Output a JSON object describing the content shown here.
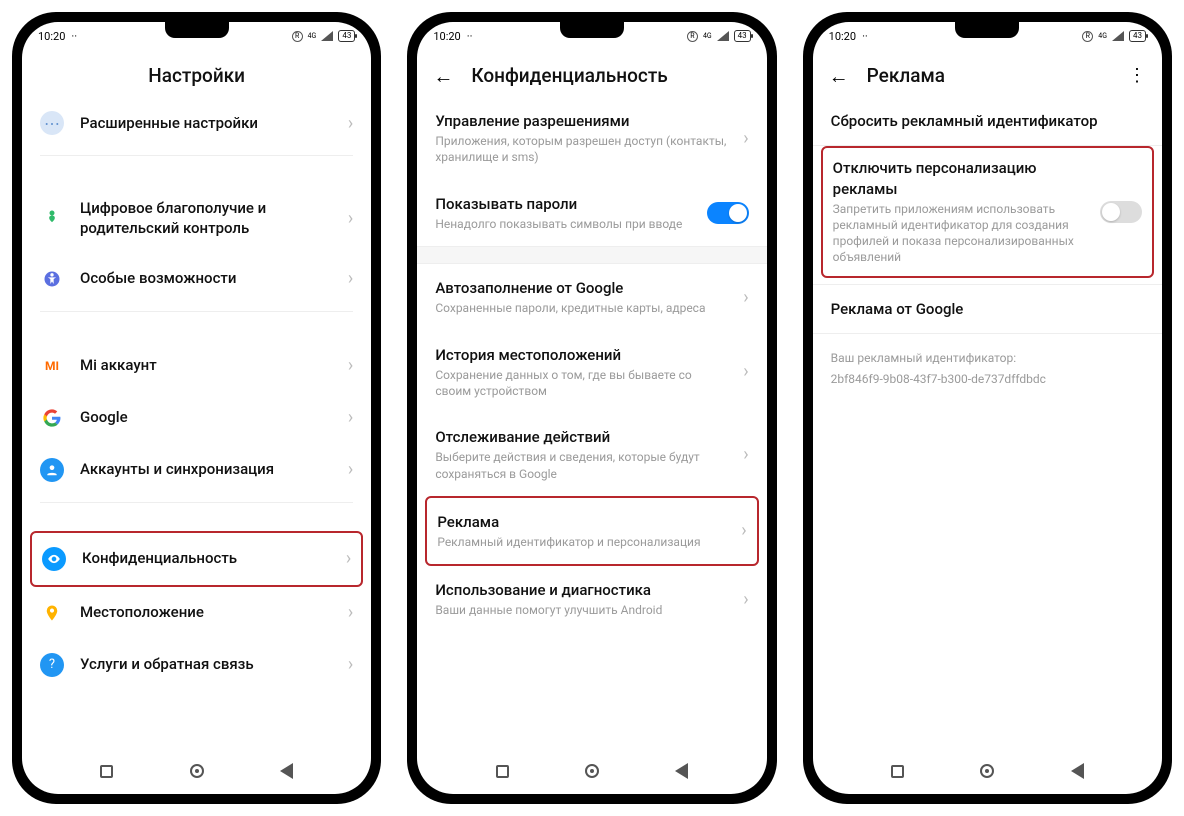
{
  "status": {
    "time": "10:20",
    "dots": "··",
    "r_label": "R",
    "net": "4G",
    "signal": "▮▯",
    "battery": "43"
  },
  "nav": {
    "recent": "recent",
    "home": "home",
    "back": "back"
  },
  "phone1": {
    "title": "Настройки",
    "items": [
      {
        "icon": "dots",
        "label": "Расширенные настройки"
      },
      {
        "icon": "heart",
        "label": "Цифровое благополучие и родительский контроль"
      },
      {
        "icon": "acc",
        "label": "Особые возможности"
      },
      {
        "icon": "mi",
        "label": "Mi аккаунт"
      },
      {
        "icon": "g",
        "label": "Google"
      },
      {
        "icon": "user",
        "label": "Аккаунты и синхронизация"
      },
      {
        "icon": "eye",
        "label": "Конфиденциальность",
        "highlight": true
      },
      {
        "icon": "loc",
        "label": "Местоположение"
      },
      {
        "icon": "help",
        "label": "Услуги и обратная связь"
      }
    ]
  },
  "phone2": {
    "title": "Конфиденциальность",
    "items": [
      {
        "label": "Управление разрешениями",
        "sub": "Приложения, которым разрешен доступ (контакты, хранилище и sms)",
        "chevron": true
      },
      {
        "label": "Показывать пароли",
        "sub": "Ненадолго показывать символы при вводе",
        "toggle": "on"
      },
      {
        "label": "Автозаполнение от Google",
        "sub": "Сохраненные пароли, кредитные карты, адреса",
        "chevron": true
      },
      {
        "label": "История местоположений",
        "sub": "Сохранение данных о том, где вы бываете со своим устройством",
        "chevron": true
      },
      {
        "label": "Отслеживание действий",
        "sub": "Выберите действия и сведения, которые будут сохраняться в Google",
        "chevron": true
      },
      {
        "label": "Реклама",
        "sub": "Рекламный идентификатор и персонализация",
        "chevron": true,
        "highlight": true
      },
      {
        "label": "Использование и диагностика",
        "sub": "Ваши данные помогут улучшить Android",
        "chevron": true
      }
    ]
  },
  "phone3": {
    "title": "Реклама",
    "items": [
      {
        "label": "Сбросить рекламный идентификатор",
        "chevron": false
      },
      {
        "label": "Отключить персонализацию рекламы",
        "sub": "Запретить приложениям использовать рекламный идентификатор для создания профилей и показа персонализированных объявлений",
        "toggle": "off",
        "highlight": true
      },
      {
        "label": "Реклама от Google",
        "chevron": false
      }
    ],
    "footer_label": "Ваш рекламный идентификатор:",
    "footer_value": "2bf846f9-9b08-43f7-b300-de737dffdbdc"
  }
}
